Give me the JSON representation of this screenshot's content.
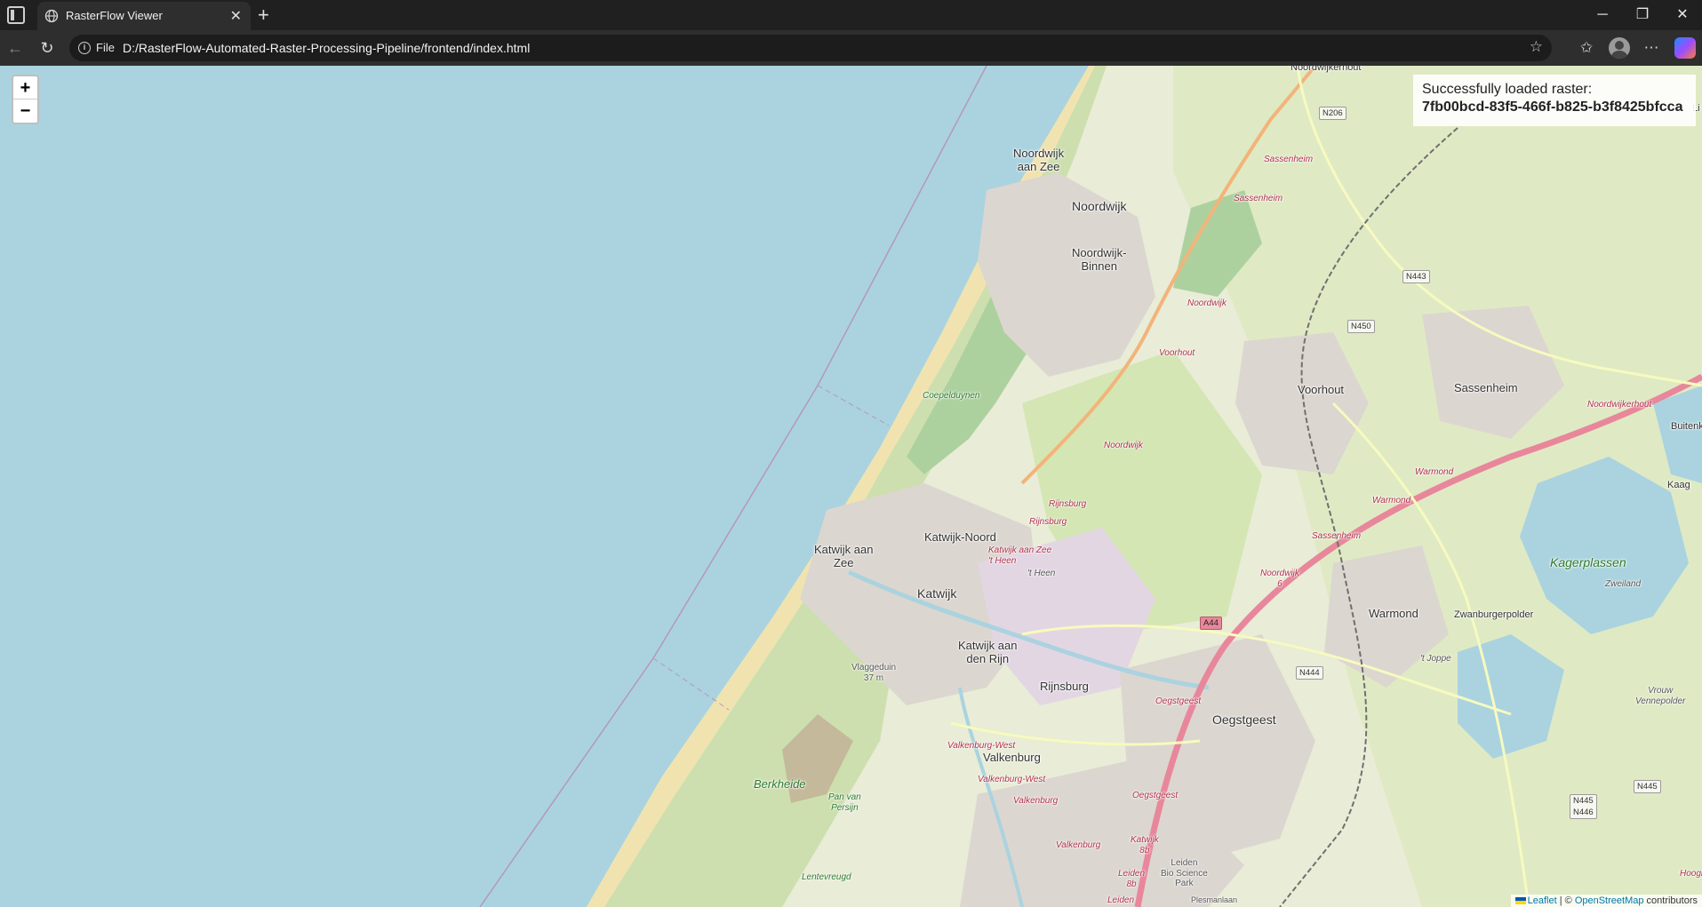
{
  "browser": {
    "tab_title": "RasterFlow Viewer",
    "url_scheme": "File",
    "url": "D:/RasterFlow-Automated-Raster-Processing-Pipeline/frontend/index.html"
  },
  "icons": {
    "tab_actions": "tab-actions-icon",
    "tab_favicon": "globe-icon",
    "tab_close": "close-icon",
    "new_tab": "plus-icon",
    "back": "back-arrow-icon",
    "reload": "reload-icon",
    "site_info": "info-icon",
    "favorite": "star-icon",
    "favorites": "favorites-icon",
    "profile": "profile-icon",
    "more": "more-icon",
    "copilot": "copilot-icon",
    "minimize": "minimize-icon",
    "restore": "restore-icon",
    "close_window": "close-icon"
  },
  "map": {
    "zoom_in": "+",
    "zoom_out": "−",
    "status_line": "Successfully loaded raster:",
    "raster_id": "7fb00bcd-83f5-466f-b825-b3f8425bfcca",
    "attribution": {
      "leaflet": "Leaflet",
      "separator": " | © ",
      "osm": "OpenStreetMap",
      "contributors": " contributors"
    },
    "labels": {
      "noordwijkerhout": "Noordwijkerhout",
      "noordwijk_aan_zee": "Noordwijk\naan Zee",
      "noordwijk": "Noordwijk",
      "noordwijk_binnen": "Noordwijk-\nBinnen",
      "voorhout": "Voorhout",
      "sassenheim": "Sassenheim",
      "katwijk_aan_zee": "Katwijk aan\nZee",
      "katwijk_noord": "Katwijk-Noord",
      "katwijk": "Katwijk",
      "katwijk_aan_den_rijn": "Katwijk aan\nden Rijn",
      "rijnsburg": "Rijnsburg",
      "oegstgeest": "Oegstgeest",
      "valkenburg": "Valkenburg",
      "warmond": "Warmond",
      "zwanburgerpolder": "Zwanburgerpolder",
      "kagerplassen": "Kagerplassen",
      "kaag": "Kaag",
      "buitenkaag": "Buitenka",
      "berkheide": "Berkheide",
      "coepelduynen": "Coepelduynen",
      "vlaggeduin": "Vlaggeduin\n37 m",
      "pan_van_persijn": "Pan van\nPersijn",
      "lentevreugd": "Lentevreugd",
      "leiden_bio_science_park": "Leiden\nBio Science\nPark",
      "vrouw_vennepolder": "Vrouw\nVennepolder",
      "t_heen": "'t Heen",
      "zweiland": "Zweiland",
      "t_joppe": "'t Joppe",
      "li": "Li",
      "hoogm": "Hoogm",
      "red_sassenheim_1": "Sassenheim",
      "red_sassenheim_2": "Sassenheim",
      "red_sassenheim_3": "Sassenheim",
      "red_noordwijk_1": "Noordwijk",
      "red_noordwijk_2": "Noordwijk",
      "red_noordwijk_6": "Noordwijk\n6",
      "red_voorhout": "Voorhout",
      "red_rijnsburg_1": "Rijnsburg",
      "red_rijnsburg_2": "Rijnsburg",
      "red_katwijk_aan_zee": "Katwijk aan Zee\n't Heen",
      "red_warmond_1": "Warmond",
      "red_warmond_2": "Warmond",
      "red_noordwijkerhout": "Noordwijkerhout",
      "red_oegstgeest_1": "Oegstgeest",
      "red_oegstgeest_2": "Oegstgeest",
      "red_valkenburg_west_1": "Valkenburg-West",
      "red_valkenburg_west_2": "Valkenburg-West",
      "red_valkenburg_1": "Valkenburg",
      "red_valkenburg_2": "Valkenburg",
      "red_katwijk": "Katwijk\n8b",
      "red_leiden": "Leiden\n8b",
      "red_leiden_2": "Leiden",
      "plesmanlaan": "Plesmanlaan"
    },
    "road_shields": {
      "n206": "N206",
      "n443": "N443",
      "n450": "N450",
      "a44": "A44",
      "n444": "N444",
      "n445": "N445",
      "n445_n446": "N445\nN446"
    }
  },
  "colors": {
    "sea": "#aad3df",
    "land": "#f2efe9",
    "farmland": "#dfe8c4",
    "dunes": "#cddfae",
    "beach": "#f1e3b0",
    "urban": "#dcd6d0",
    "highway": "#e8879b",
    "water": "#aad3df"
  }
}
